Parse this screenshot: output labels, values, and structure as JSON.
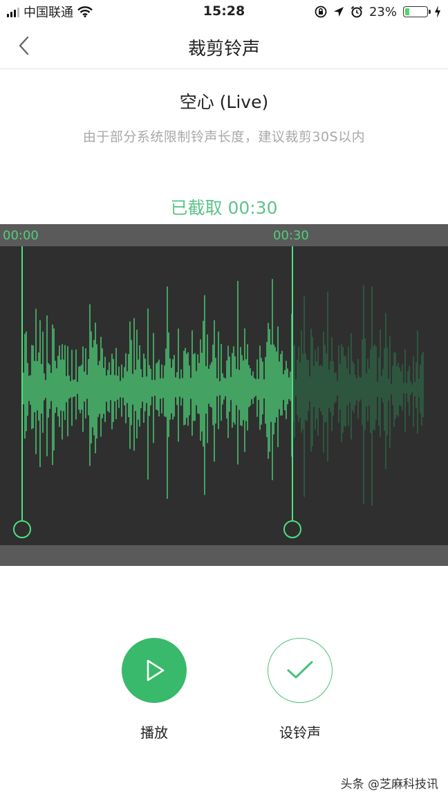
{
  "status_bar": {
    "carrier": "中国联通",
    "time": "15:28",
    "battery_percent": "23%",
    "battery_level": 0.23,
    "icons": [
      "signal-icon",
      "wifi-icon",
      "orientation-lock-icon",
      "location-icon",
      "alarm-icon",
      "battery-icon",
      "charging-icon"
    ]
  },
  "nav": {
    "title": "裁剪铃声",
    "back_icon": "chevron-left-icon"
  },
  "song": {
    "title": "空心 (Live)",
    "hint": "由于部分系统限制铃声长度，建议裁剪30S以内"
  },
  "trim": {
    "status": "已截取 00:30",
    "start_label": "00:00",
    "end_label": "00:30",
    "selected_seconds": 30
  },
  "colors": {
    "accent": "#39b96b",
    "waveform_selected": "#4fe07f",
    "waveform_unselected": "#2e6b48",
    "editor_background": "#2f2f2f",
    "ruler_background": "#5a5a5a"
  },
  "actions": {
    "play_label": "播放",
    "play_icon": "play-icon",
    "set_label": "设铃声",
    "set_icon": "checkmark-icon"
  },
  "watermark": "头条 @芝麻科技讯"
}
